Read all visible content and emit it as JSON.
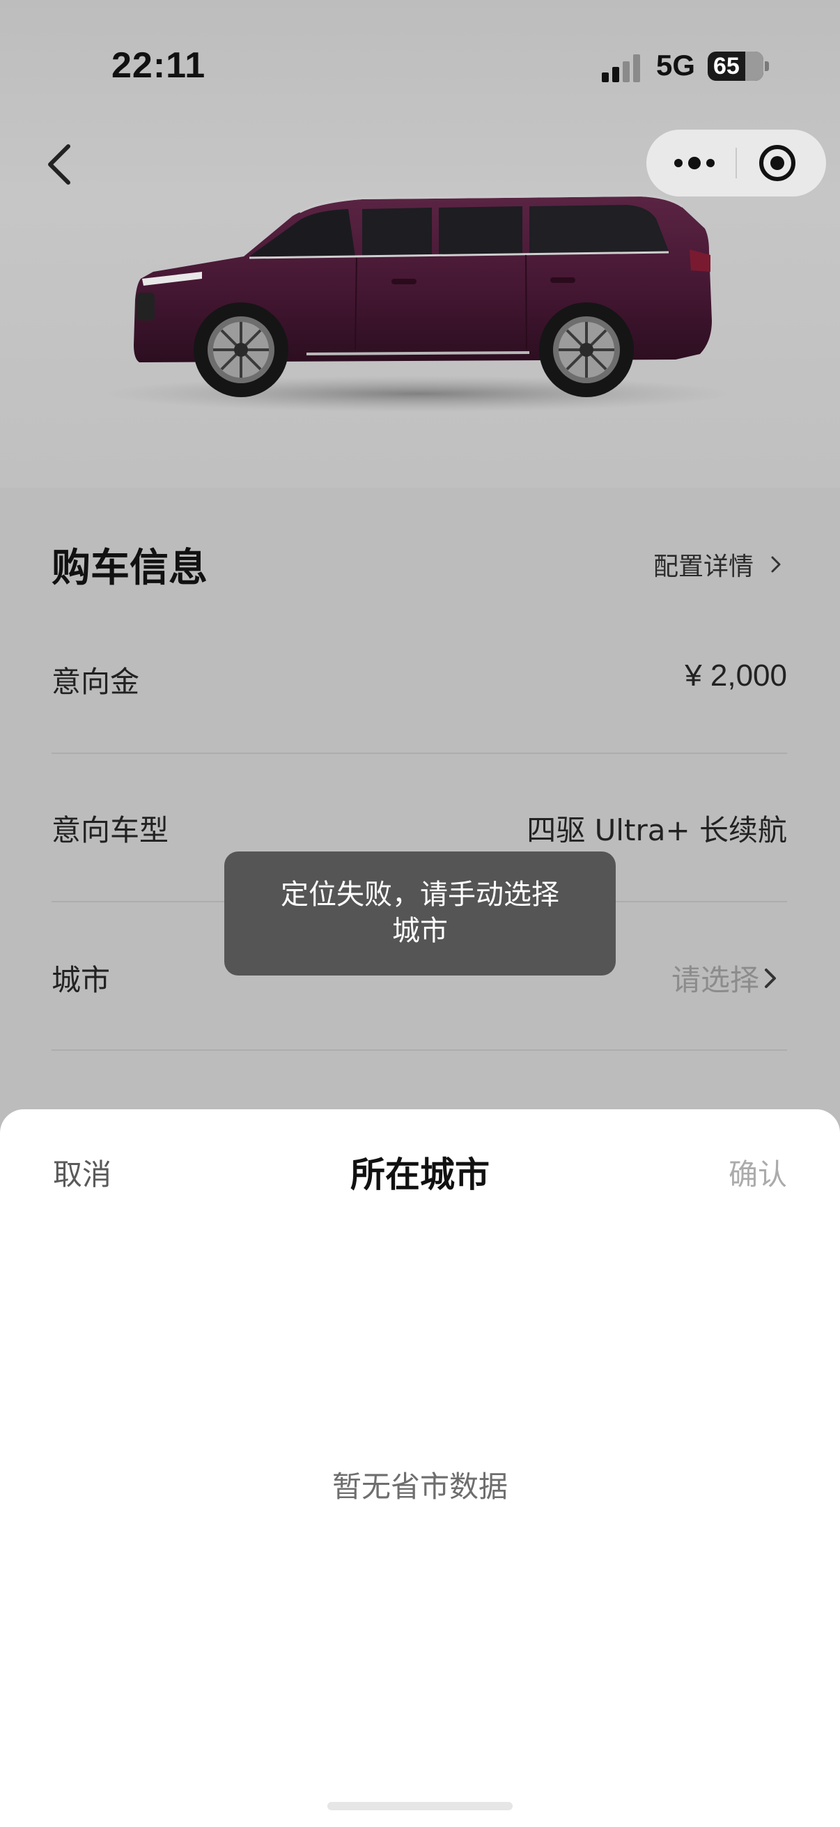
{
  "status_bar": {
    "time": "22:11",
    "network": "5G",
    "battery": "65"
  },
  "nav": {
    "back_icon": "chevron-left-icon",
    "more_icon": "more-dots-icon",
    "close_icon": "target-circle-icon"
  },
  "car": {
    "color": "#4a1a35"
  },
  "purchase_info": {
    "title": "购车信息",
    "config_link": "配置详情",
    "rows": [
      {
        "label": "意向金",
        "value": "¥ 2,000"
      },
      {
        "label": "意向车型",
        "value": "四驱 Ultra+ 长续航"
      },
      {
        "label": "城市",
        "value": "请选择"
      }
    ]
  },
  "toast": {
    "line1": "定位失败，请手动选择",
    "line2": "城市"
  },
  "city_sheet": {
    "cancel": "取消",
    "title": "所在城市",
    "confirm": "确认",
    "empty_text": "暂无省市数据"
  }
}
